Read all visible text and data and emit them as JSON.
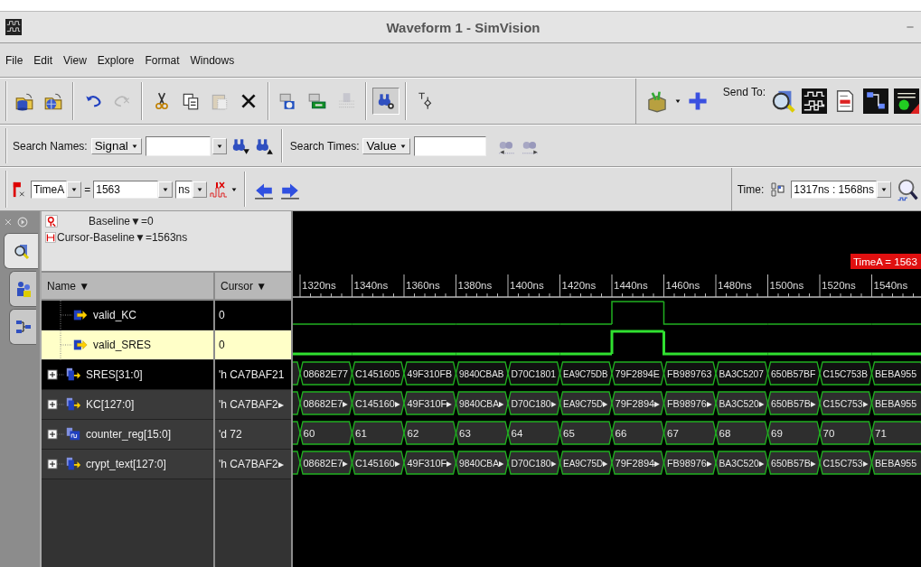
{
  "window": {
    "title": "Waveform 1 - SimVision"
  },
  "menu": [
    {
      "label": "File"
    },
    {
      "label": "Edit"
    },
    {
      "label": "View"
    },
    {
      "label": "Explore"
    },
    {
      "label": "Format"
    },
    {
      "label": "Windows"
    }
  ],
  "toolbar": {
    "buttons": [
      {
        "disabled": false,
        "pressed": false
      },
      {
        "disabled": false,
        "pressed": false
      },
      {
        "disabled": false,
        "pressed": false
      },
      {
        "disabled": true,
        "pressed": false
      },
      {
        "disabled": false,
        "pressed": false
      },
      {
        "disabled": false,
        "pressed": false
      },
      {
        "disabled": true,
        "pressed": false
      },
      {
        "disabled": false,
        "pressed": false
      },
      {
        "disabled": false,
        "pressed": false
      },
      {
        "disabled": false,
        "pressed": false
      },
      {
        "disabled": true,
        "pressed": false
      },
      {
        "disabled": false,
        "pressed": true
      },
      {
        "disabled": false,
        "pressed": false
      }
    ],
    "send_to_label": "Send To:"
  },
  "search_bar": {
    "names_label": "Search Names:",
    "names_mode": "Signal",
    "times_label": "Search Times:",
    "times_mode": "Value"
  },
  "cursor_bar": {
    "cursor": "TimeA",
    "equals": "=",
    "value": "1563",
    "unit": "ns",
    "time_label": "Time:",
    "time_range": "1317ns : 1568ns"
  },
  "side_tabs": [
    {
      "selected": true
    },
    {
      "selected": false
    },
    {
      "selected": false
    }
  ],
  "baseline": {
    "baseline": "Baseline▼=0",
    "delta": "Cursor-Baseline▼=1563ns"
  },
  "columns": [
    "Name ▼",
    "Cursor ▼"
  ],
  "time_axis": {
    "ticks": [
      "1320ns",
      "1340ns",
      "1360ns",
      "1380ns",
      "1400ns",
      "1420ns",
      "1440ns",
      "1460ns",
      "1480ns",
      "1500ns",
      "1520ns",
      "1540ns"
    ],
    "marker": "TimeA = 1563"
  },
  "signals": [
    {
      "name": "valid_KC",
      "cursor": "0",
      "kind": "bit",
      "selected": false,
      "shaded": false,
      "high": [
        false,
        false,
        false,
        false,
        false,
        false,
        true,
        false,
        false,
        false,
        false,
        false
      ]
    },
    {
      "name": "valid_SRES",
      "cursor": "0",
      "kind": "bit",
      "selected": true,
      "shaded": false,
      "high": [
        false,
        false,
        false,
        false,
        false,
        false,
        true,
        false,
        false,
        false,
        false,
        false
      ]
    },
    {
      "name": "SRES[31:0]",
      "cursor": "'h CA7BAF21",
      "kind": "bus",
      "selected": false,
      "shaded": false,
      "expanded": false,
      "values": [
        "08682E77",
        "C1451605",
        "49F310FB",
        "9840CBAB",
        "D70C1801",
        "EA9C75DB",
        "79F2894E",
        "FB989763",
        "BA3C5207",
        "650B57BF",
        "C15C753B",
        "BEBA955"
      ]
    },
    {
      "name": "KC[127:0]",
      "cursor": "'h CA7BAF2▸",
      "kind": "bus",
      "selected": false,
      "shaded": true,
      "expanded": false,
      "values": [
        "08682E7▸",
        "C145160▸",
        "49F310F▸",
        "9840CBA▸",
        "D70C180▸",
        "EA9C75D▸",
        "79F2894▸",
        "FB98976▸",
        "BA3C520▸",
        "650B57B▸",
        "C15C753▸",
        "BEBA955"
      ]
    },
    {
      "name": "counter_reg[15:0]",
      "cursor": "'d 72",
      "kind": "counter",
      "selected": false,
      "shaded": true,
      "expanded": false,
      "values": [
        "60",
        "61",
        "62",
        "63",
        "64",
        "65",
        "66",
        "67",
        "68",
        "69",
        "70",
        "71"
      ]
    },
    {
      "name": "crypt_text[127:0]",
      "cursor": "'h CA7BAF2▸",
      "kind": "bus",
      "selected": false,
      "shaded": true,
      "expanded": false,
      "values": [
        "08682E7▸",
        "C145160▸",
        "49F310F▸",
        "9840CBA▸",
        "D70C180▸",
        "EA9C75D▸",
        "79F2894▸",
        "FB98976▸",
        "BA3C520▸",
        "650B57B▸",
        "C15C753▸",
        "BEBA955"
      ]
    }
  ]
}
